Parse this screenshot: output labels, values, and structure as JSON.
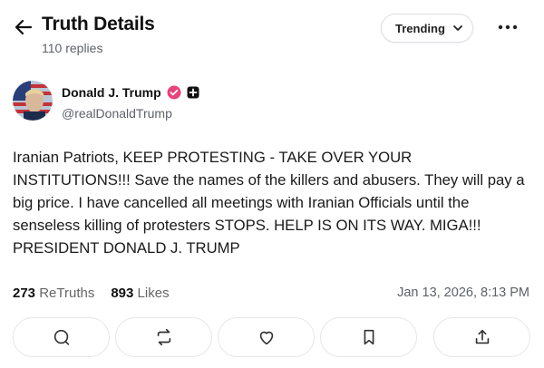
{
  "header": {
    "title": "Truth Details",
    "replies": "110 replies",
    "sort_label": "Trending"
  },
  "author": {
    "name": "Donald J. Trump",
    "handle": "@realDonaldTrump",
    "verified_color": "#e8437a"
  },
  "post": {
    "text": "Iranian Patriots, KEEP PROTESTING - TAKE OVER YOUR INSTITUTIONS!!! Save the names of the killers and abusers. They will pay a big price. I have cancelled all meetings with Iranian Officials until the senseless killing of protesters STOPS. HELP IS ON ITS WAY. MIGA!!! PRESIDENT DONALD J. TRUMP",
    "retruths_count": "273",
    "retruths_label": "ReTruths",
    "likes_count": "893",
    "likes_label": "Likes",
    "timestamp": "Jan 13, 2026, 8:13 PM"
  },
  "actions": [
    "reply-icon",
    "retruth-icon",
    "like-icon",
    "bookmark-icon",
    "share-icon"
  ]
}
